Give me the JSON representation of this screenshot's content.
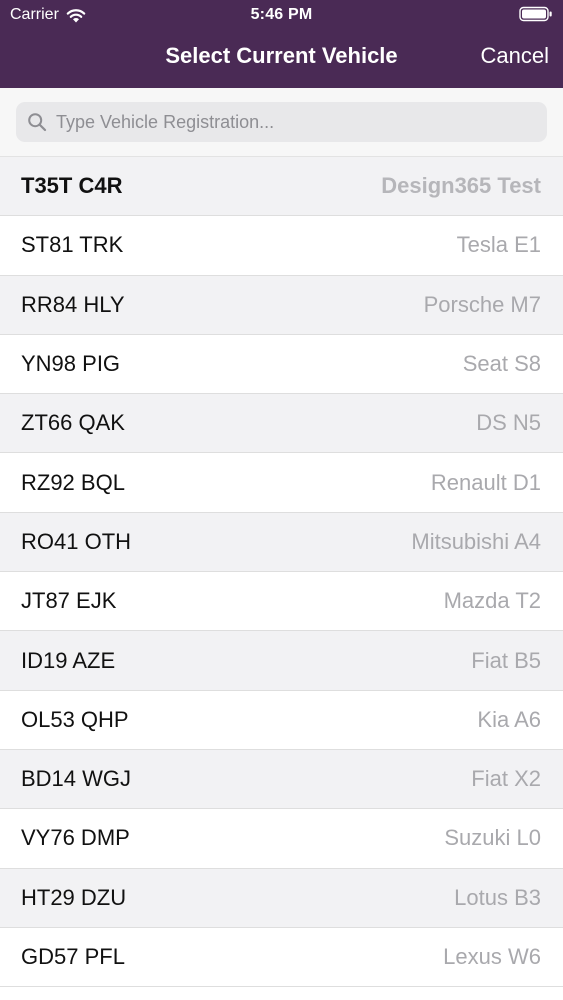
{
  "status_bar": {
    "carrier": "Carrier",
    "time": "5:46 PM",
    "wifi_icon": "wifi-icon",
    "battery_icon": "battery-icon"
  },
  "nav": {
    "title": "Select Current Vehicle",
    "cancel_label": "Cancel"
  },
  "search": {
    "placeholder": "Type Vehicle Registration...",
    "value": "",
    "icon": "search-icon"
  },
  "colors": {
    "header_bg": "#4a2a55",
    "header_text": "#ffffff",
    "row_alt_bg": "#f2f2f4",
    "model_text": "#a9a9ad"
  },
  "vehicles": [
    {
      "registration": "T35T C4R",
      "model": "Design365 Test",
      "current": true
    },
    {
      "registration": "ST81 TRK",
      "model": "Tesla E1"
    },
    {
      "registration": "RR84 HLY",
      "model": "Porsche M7"
    },
    {
      "registration": "YN98 PIG",
      "model": "Seat S8"
    },
    {
      "registration": "ZT66 QAK",
      "model": "DS N5"
    },
    {
      "registration": "RZ92 BQL",
      "model": "Renault D1"
    },
    {
      "registration": "RO41 OTH",
      "model": "Mitsubishi A4"
    },
    {
      "registration": "JT87 EJK",
      "model": "Mazda T2"
    },
    {
      "registration": "ID19 AZE",
      "model": "Fiat B5"
    },
    {
      "registration": "OL53 QHP",
      "model": "Kia A6"
    },
    {
      "registration": "BD14 WGJ",
      "model": "Fiat X2"
    },
    {
      "registration": "VY76 DMP",
      "model": "Suzuki L0"
    },
    {
      "registration": "HT29 DZU",
      "model": "Lotus B3"
    },
    {
      "registration": "GD57 PFL",
      "model": "Lexus W6"
    }
  ]
}
